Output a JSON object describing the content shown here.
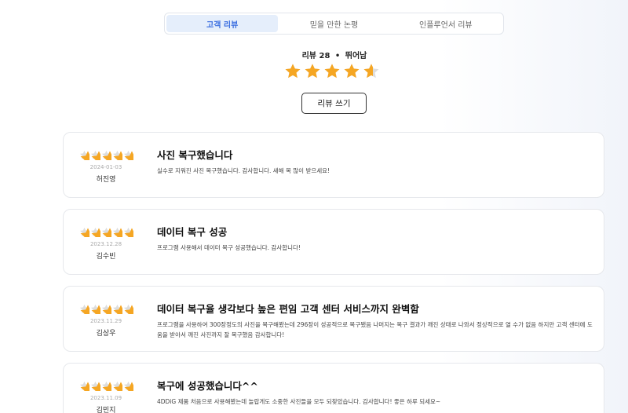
{
  "tabs": [
    {
      "label": "고객 리뷰",
      "active": true
    },
    {
      "label": "믿을 만한 논평",
      "active": false
    },
    {
      "label": "인플루언서 리뷰",
      "active": false
    }
  ],
  "summary": {
    "label": "리뷰",
    "count": "28",
    "separator": "•",
    "rating_text": "뛰어남",
    "rating": 4.6
  },
  "write_review_button": "리뷰 쓰기",
  "colors": {
    "star": "#f5a623",
    "star_empty": "#dddddd",
    "active_tab_bg": "#e5eefb",
    "active_tab_text": "#3a6ee0"
  },
  "reviews": [
    {
      "title": "사진 복구했습니다",
      "body": "실수로 지워진 사진 복구했습니다. 감사합니다. 새해 복 많이 받으세요!",
      "date": "2024-01-03",
      "author": "허진영",
      "rating": 5
    },
    {
      "title": "데이터 복구 성공",
      "body": "프로그램 사용해서 데이터 복구 성공했습니다. 감사합니다!",
      "date": "2023.12.28",
      "author": "김수빈",
      "rating": 5
    },
    {
      "title": "데이터 복구율 생각보다 높은 편임 고객 센터 서비스까지 완벽함",
      "body": "프로그램을 사용하여 300장정도의 사진을 복구해봤는데 296장이 성공적으로 복구됐음 나머지는 복구 결과가 깨진 상태로 나와서 정상적으로 열 수가 없음 하지만 고객 센터에 도움을 받아서 깨진 사진까지 잘 복구했음 감사합니다!",
      "date": "2023.11.29",
      "author": "김상우",
      "rating": 5
    },
    {
      "title": "복구에 성공했습니다^^",
      "body": "4DDiG 제품 처음으로 사용해봤는데 놀랍게도 소중한 사진들을 모두 되찾았습니다. 감사합니다! 좋은 하루 되세요~",
      "date": "2023.11.09",
      "author": "김민지",
      "rating": 5
    }
  ]
}
